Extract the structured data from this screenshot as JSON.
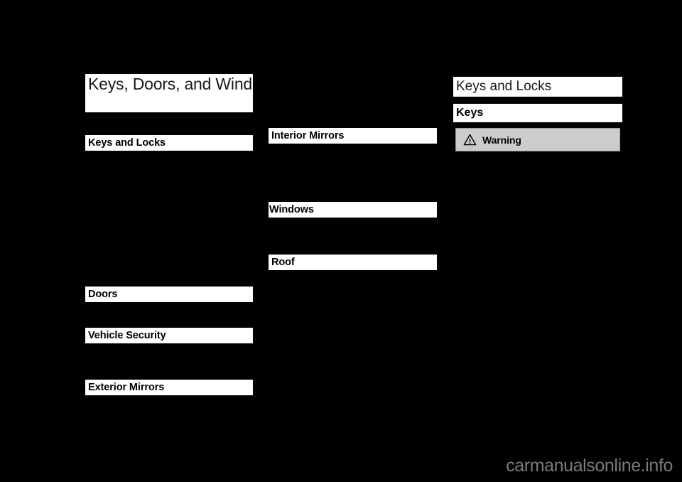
{
  "document": {
    "background_color": "#000000",
    "panel_color": "#ffffff",
    "warning_color": "#cccccc"
  },
  "chapter": {
    "title": "Keys, Doors, and Windows"
  },
  "toc": {
    "columns": [
      {
        "name": "column-left",
        "headings": [
          {
            "label": "Keys and Locks"
          },
          {
            "label": "Doors"
          },
          {
            "label": "Vehicle Security"
          },
          {
            "label": "Exterior Mirrors"
          }
        ]
      },
      {
        "name": "column-middle",
        "headings": [
          {
            "label": "Interior Mirrors"
          },
          {
            "label": "Windows"
          },
          {
            "label": "Roof"
          }
        ]
      }
    ]
  },
  "article": {
    "running_head": "Keys and Locks",
    "section_heading": "Keys",
    "warning": {
      "icon": "warning-triangle-icon",
      "label": "Warning"
    }
  },
  "watermark": {
    "text": "carmanualsonline.info"
  }
}
